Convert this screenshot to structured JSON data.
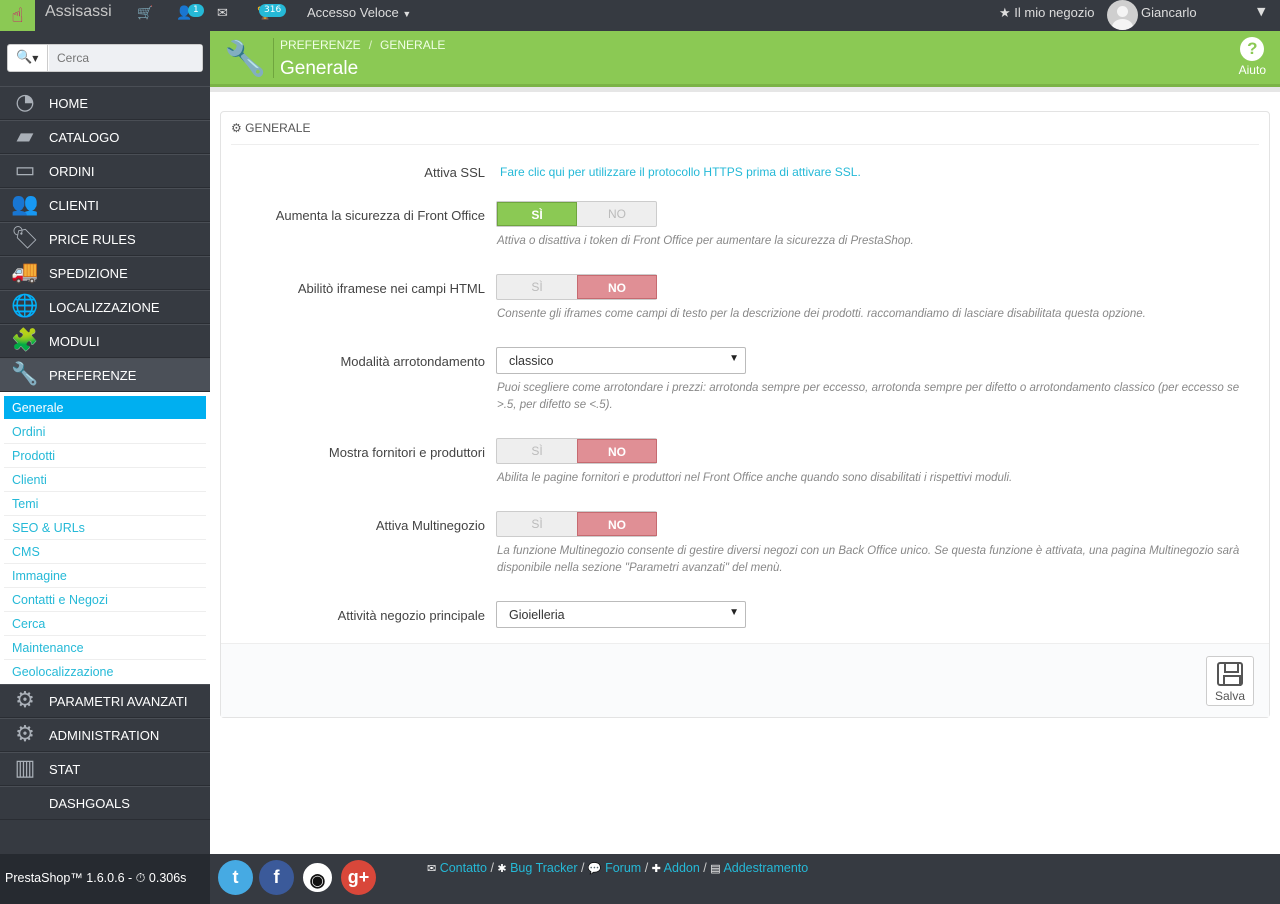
{
  "topbar": {
    "shop_name": "Assisassi",
    "cart_icon": "cart-icon",
    "customers_badge": "1",
    "messages_icon": "envelope-icon",
    "trophy_badge": "316",
    "quick_access": "Accesso Veloce",
    "my_shop": "Il mio negozio",
    "user_name": "Giancarlo"
  },
  "sidebar": {
    "search_placeholder": "Cerca",
    "menu": [
      {
        "label": "HOME",
        "icon": "dashboard-icon"
      },
      {
        "label": "CATALOGO",
        "icon": "book-icon"
      },
      {
        "label": "ORDINI",
        "icon": "credit-card-icon"
      },
      {
        "label": "CLIENTI",
        "icon": "users-icon"
      },
      {
        "label": "PRICE RULES",
        "icon": "tags-icon"
      },
      {
        "label": "SPEDIZIONE",
        "icon": "truck-icon"
      },
      {
        "label": "LOCALIZZAZIONE",
        "icon": "globe-icon"
      },
      {
        "label": "MODULI",
        "icon": "puzzle-icon"
      },
      {
        "label": "PREFERENZE",
        "icon": "wrench-icon"
      }
    ],
    "submenu": [
      "Generale",
      "Ordini",
      "Prodotti",
      "Clienti",
      "Temi",
      "SEO & URLs",
      "CMS",
      "Immagine",
      "Contatti e Negozi",
      "Cerca",
      "Maintenance",
      "Geolocalizzazione"
    ],
    "menu_after": [
      {
        "label": "PARAMETRI AVANZATI",
        "icon": "cogs-icon"
      },
      {
        "label": "ADMINISTRATION",
        "icon": "cog-icon"
      },
      {
        "label": "STAT",
        "icon": "bar-chart-icon"
      },
      {
        "label": "DASHGOALS",
        "icon": ""
      }
    ]
  },
  "header": {
    "breadcrumb_1": "PREFERENZE",
    "breadcrumb_2": "GENERALE",
    "title": "Generale",
    "help_label": "Aiuto"
  },
  "panel": {
    "heading": "GENERALE",
    "ssl_label": "Attiva SSL",
    "ssl_link": "Fare clic qui per utilizzare il protocollo HTTPS prima di attivare SSL.",
    "token_label": "Aumenta la sicurezza di Front Office",
    "token_help": "Attiva o disattiva i token di Front Office per aumentare la sicurezza di PrestaShop.",
    "iframe_label": "Abilitò iframese nei campi HTML",
    "iframe_help": "Consente gli iframes come campi di testo per la descrizione dei prodotti. raccomandiamo di lasciare disabilitata questa opzione.",
    "rounding_label": "Modalità arrotondamento",
    "rounding_value": "classico",
    "rounding_help": "Puoi scegliere come arrotondare i prezzi: arrotonda sempre per eccesso, arrotonda sempre per difetto o arrotondamento classico (per eccesso se >.5, per difetto se <.5).",
    "suppliers_label": "Mostra fornitori e produttori",
    "suppliers_help": "Abilita le pagine fornitori e produttori nel Front Office anche quando sono disabilitati i rispettivi moduli.",
    "multistore_label": "Attiva Multinegozio",
    "multistore_help": "La funzione Multinegozio consente di gestire diversi negozi con un Back Office unico. Se questa funzione è attivata, una pagina Multinegozio sarà disponibile nella sezione \"Parametri avanzati\" del menù.",
    "activity_label": "Attività negozio principale",
    "activity_value": "Gioielleria",
    "yes": "SÌ",
    "no": "NO",
    "save": "Salva"
  },
  "toggles": {
    "token": "yes",
    "iframe": "no",
    "suppliers": "no",
    "multistore": "no"
  },
  "footer": {
    "version": "PrestaShop™ 1.6.0.6 - ",
    "time": "0.306s",
    "links": [
      "Contatto",
      "Bug Tracker",
      "Forum",
      "Addon",
      "Addestramento"
    ],
    "social": [
      "twitter-icon",
      "facebook-icon",
      "github-icon",
      "google-plus-icon"
    ]
  },
  "colors": {
    "accent_green": "#8bc954",
    "toggle_no_red": "#e08f95",
    "link_blue": "#25b9d7",
    "active_sub": "#00aff0",
    "sidebar_bg": "#363a41"
  }
}
